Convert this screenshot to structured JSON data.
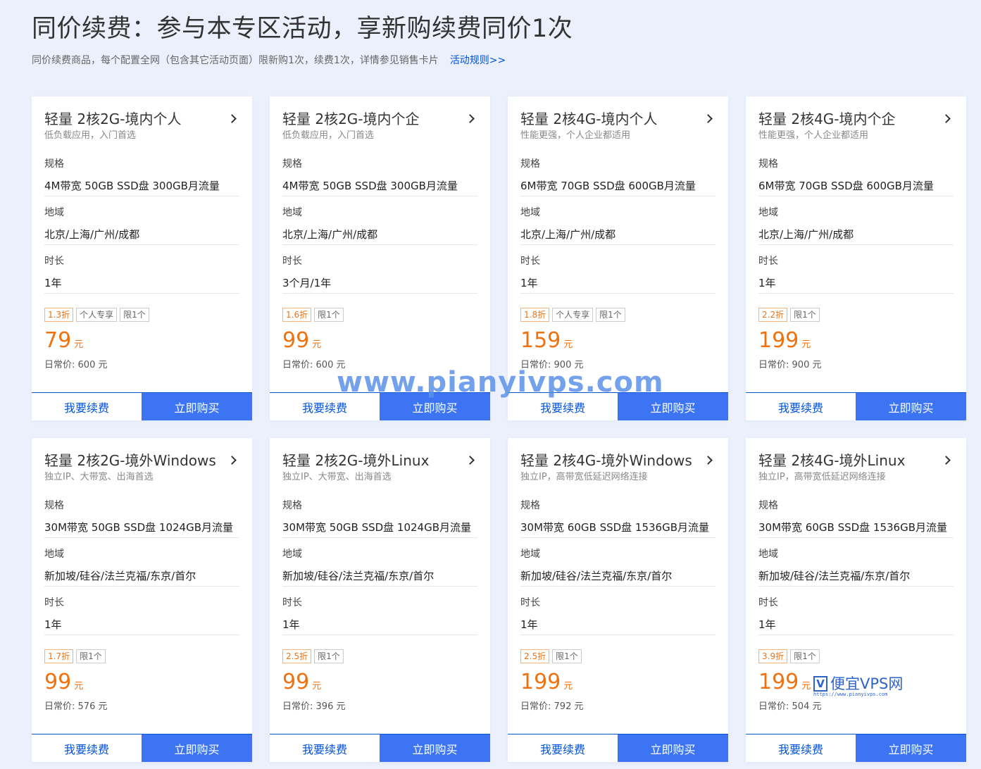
{
  "header": {
    "title": "同价续费：参与本专区活动，享新购续费同价1次",
    "subtitle": "同价续费商品，每个配置全网（包含其它活动页面）限新购1次，续费1次，详情参见销售卡片",
    "rules_link": "活动规则>>"
  },
  "labels": {
    "spec": "规格",
    "region": "地域",
    "duration": "时长",
    "regular_price": "日常价:",
    "currency": "元",
    "renew_button": "我要续费",
    "buy_button": "立即购买"
  },
  "cards": [
    {
      "title": "轻量 2核2G-境内个人",
      "desc": "低负载应用，入门首选",
      "spec": "4M带宽 50GB SSD盘 300GB月流量",
      "region": "北京/上海/广州/成都",
      "duration": "1年",
      "tags": [
        "1.3折",
        "个人专享",
        "限1个"
      ],
      "price": "79",
      "regular": "600 元"
    },
    {
      "title": "轻量 2核2G-境内个企",
      "desc": "低负载应用，入门首选",
      "spec": "4M带宽 50GB SSD盘 300GB月流量",
      "region": "北京/上海/广州/成都",
      "duration": "3个月/1年",
      "tags": [
        "1.6折",
        "限1个"
      ],
      "price": "99",
      "regular": "600 元"
    },
    {
      "title": "轻量 2核4G-境内个人",
      "desc": "性能更强，个人企业都适用",
      "spec": "6M带宽 70GB SSD盘 600GB月流量",
      "region": "北京/上海/广州/成都",
      "duration": "1年",
      "tags": [
        "1.8折",
        "个人专享",
        "限1个"
      ],
      "price": "159",
      "regular": "900 元"
    },
    {
      "title": "轻量 2核4G-境内个企",
      "desc": "性能更强，个人企业都适用",
      "spec": "6M带宽 70GB SSD盘 600GB月流量",
      "region": "北京/上海/广州/成都",
      "duration": "1年",
      "tags": [
        "2.2折",
        "限1个"
      ],
      "price": "199",
      "regular": "900 元"
    },
    {
      "title": "轻量 2核2G-境外Windows",
      "desc": "独立IP、大带宽、出海首选",
      "spec": "30M带宽 50GB SSD盘 1024GB月流量",
      "region": "新加坡/硅谷/法兰克福/东京/首尔",
      "duration": "1年",
      "tags": [
        "1.7折",
        "限1个"
      ],
      "price": "99",
      "regular": "576 元"
    },
    {
      "title": "轻量 2核2G-境外Linux",
      "desc": "独立IP、大带宽、出海首选",
      "spec": "30M带宽 50GB SSD盘 1024GB月流量",
      "region": "新加坡/硅谷/法兰克福/东京/首尔",
      "duration": "1年",
      "tags": [
        "2.5折",
        "限1个"
      ],
      "price": "99",
      "regular": "396 元"
    },
    {
      "title": "轻量 2核4G-境外Windows",
      "desc": "独立IP，高带宽低延迟网络连接",
      "spec": "30M带宽 60GB SSD盘 1536GB月流量",
      "region": "新加坡/硅谷/法兰克福/东京/首尔",
      "duration": "1年",
      "tags": [
        "2.5折",
        "限1个"
      ],
      "price": "199",
      "regular": "792 元"
    },
    {
      "title": "轻量 2核4G-境外Linux",
      "desc": "独立IP，高带宽低延迟网络连接",
      "spec": "30M带宽 60GB SSD盘 1536GB月流量",
      "region": "新加坡/硅谷/法兰克福/东京/首尔",
      "duration": "1年",
      "tags": [
        "3.9折",
        "限1个"
      ],
      "price": "199",
      "regular": "504 元"
    }
  ],
  "watermark": {
    "text": "www.pianyivps.com",
    "logo_letter": "V",
    "logo_text": "便宜VPS网",
    "logo_url": "https://www.pianyivps.com"
  },
  "colors": {
    "accent": "#0052d9",
    "buy_button": "#3d74f3",
    "price": "#f0720f",
    "background": "#ecf0fc"
  }
}
